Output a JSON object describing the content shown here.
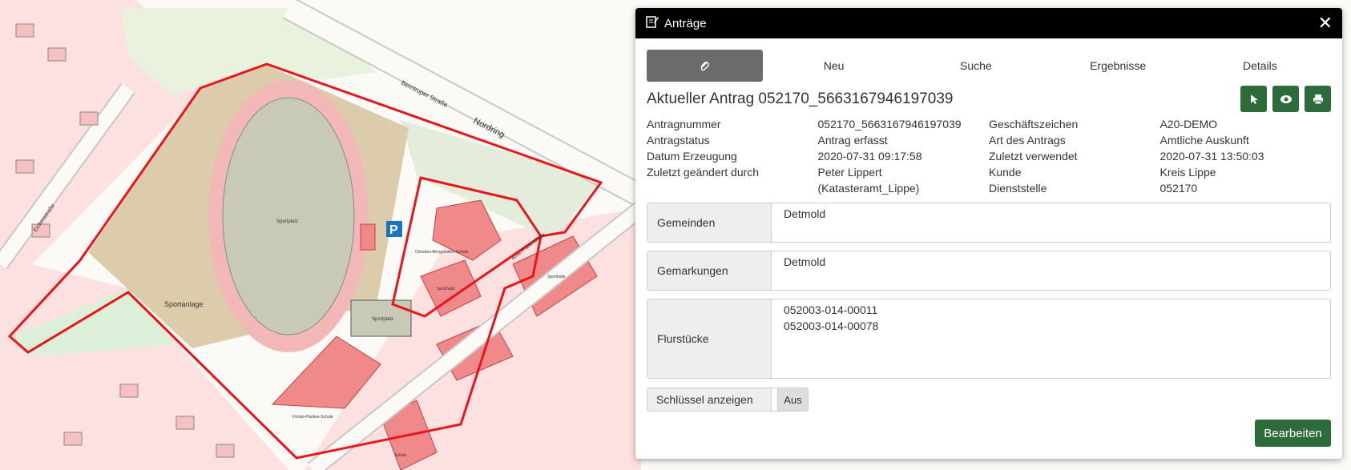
{
  "map": {
    "labels": {
      "nordring": "Nordring",
      "berntruper": "Berntruper Straße",
      "sportanlage": "Sportanlage",
      "sportplatz1": "Sportplatz",
      "sportplatz2": "Sportplatz",
      "schule": "Christian-Morgenstern-Schule",
      "sporthalle1": "Sporthalle",
      "sporthalle2": "Sporthalle",
      "fuerstin": "Fürstin-Pauline-Schule",
      "eickenstrasse": "Eickenstraße",
      "annefrank": "Anne-Frank-Straße",
      "schule2": "Schule",
      "parking": "P"
    },
    "colors": {
      "boundary": "#e8151b",
      "building": "#f08a8a",
      "grass": "#e8f2dc",
      "sand": "#dcccac"
    }
  },
  "panel": {
    "title": "Anträge",
    "close_icon": "close-icon",
    "tabs": [
      {
        "label": "",
        "icon": "paperclip-icon"
      },
      {
        "label": "Neu"
      },
      {
        "label": "Suche"
      },
      {
        "label": "Ergebnisse"
      },
      {
        "label": "Details"
      }
    ],
    "heading": "Aktueller Antrag 052170_5663167946197039",
    "info": {
      "r1": [
        "Antragnummer",
        "052170_5663167946197039",
        "Geschäftszeichen",
        "A20-DEMO"
      ],
      "r2": [
        "Antragstatus",
        "Antrag erfasst",
        "Art des Antrags",
        "Amtliche Auskunft"
      ],
      "r3": [
        "Datum Erzeugung",
        "2020-07-31 09:17:58",
        "Zuletzt verwendet",
        "2020-07-31 13:50:03"
      ],
      "r4": [
        "Zuletzt geändert durch",
        "Peter Lippert",
        "Kunde",
        "Kreis Lippe"
      ],
      "r5": [
        "",
        "(Katasteramt_Lippe)",
        "Dienststelle",
        "052170"
      ]
    },
    "gemeinden": {
      "label": "Gemeinden",
      "value": "Detmold"
    },
    "gemarkungen": {
      "label": "Gemarkungen",
      "value": "Detmold"
    },
    "flurstuecke": {
      "label": "Flurstücke",
      "values": [
        "052003-014-00011",
        "052003-014-00078"
      ]
    },
    "toggle": {
      "label": "Schlüssel anzeigen",
      "state": "Aus"
    },
    "edit_button": "Bearbeiten",
    "accent": "#2e6b3a"
  }
}
